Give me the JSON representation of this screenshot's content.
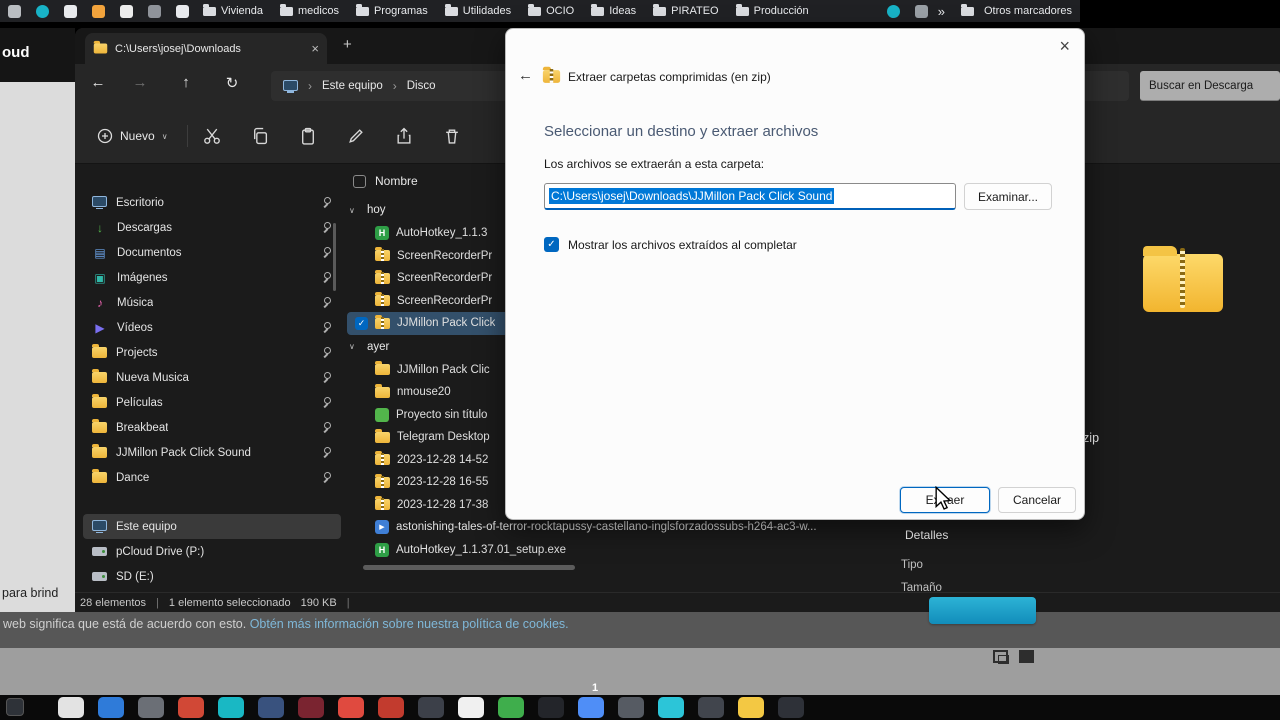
{
  "icon_glyphs": {
    "close": "×",
    "back": "←",
    "forward": "→",
    "up": "↑",
    "refresh": "↻",
    "crumb": "›",
    "plus": "+",
    "chevron": "∨",
    "check": "✓",
    "downloads": "↓",
    "documents": "▤",
    "pictures": "▣",
    "music": "♪",
    "videos": "▶"
  },
  "bookmarks": {
    "leading": [
      {
        "color": "#b9bdc1",
        "round": false
      },
      {
        "color": "#18b3c7",
        "round": true
      },
      {
        "color": "#e8eaed",
        "round": false
      },
      {
        "color": "#f2a33c",
        "round": false
      },
      {
        "color": "#ececec",
        "round": false
      },
      {
        "color": "#8f939a",
        "round": false
      },
      {
        "color": "#e8eaed",
        "round": false
      }
    ],
    "folders": [
      "Vivienda",
      "medicos",
      "Programas",
      "Utilidades",
      "OCIO",
      "Ideas",
      "PIRATEO",
      "Producción"
    ],
    "trailing": [
      {
        "color": "#18b3c7",
        "round": true
      },
      {
        "color": "#9aa0a6",
        "round": false
      }
    ],
    "overflow_chevron": "»",
    "other_bookmarks": "Otros marcadores"
  },
  "explorer": {
    "tab_title": "C:\\Users\\josej\\Downloads",
    "breadcrumb": {
      "item1": "Este equipo",
      "item2": "Disco"
    },
    "search_text": "Buscar en Descarga",
    "new_button": "Nuevo",
    "sidebar": {
      "pinned": [
        {
          "label": "Escritorio",
          "icon": "desktop"
        },
        {
          "label": "Descargas",
          "icon": "downloads"
        },
        {
          "label": "Documentos",
          "icon": "documents"
        },
        {
          "label": "Imágenes",
          "icon": "pictures"
        },
        {
          "label": "Música",
          "icon": "music"
        },
        {
          "label": "Vídeos",
          "icon": "videos"
        },
        {
          "label": "Projects",
          "icon": "folder"
        },
        {
          "label": "Nueva Musica",
          "icon": "folder"
        },
        {
          "label": "Películas",
          "icon": "folder"
        },
        {
          "label": "Breakbeat",
          "icon": "folder"
        },
        {
          "label": "JJMillon Pack Click Sound",
          "icon": "folder"
        },
        {
          "label": "Dance",
          "icon": "folder"
        }
      ],
      "devices": [
        {
          "label": "Este equipo",
          "icon": "computer",
          "selected": true
        },
        {
          "label": "pCloud Drive (P:)",
          "icon": "drive",
          "selected": false
        },
        {
          "label": "SD (E:)",
          "icon": "drive",
          "selected": false
        }
      ]
    },
    "files": {
      "column": "Nombre",
      "groups": [
        {
          "label": "hoy",
          "items": [
            {
              "name": "AutoHotkey_1.1.3",
              "icon": "exe",
              "selected": false
            },
            {
              "name": "ScreenRecorderPr",
              "icon": "zip",
              "selected": false
            },
            {
              "name": "ScreenRecorderPr",
              "icon": "zip",
              "selected": false
            },
            {
              "name": "ScreenRecorderPr",
              "icon": "zip",
              "selected": false
            },
            {
              "name": "JJMillon Pack Click",
              "icon": "zip",
              "selected": true
            }
          ]
        },
        {
          "label": "ayer",
          "items": [
            {
              "name": "JJMillon Pack Clic",
              "icon": "folder",
              "selected": false
            },
            {
              "name": "nmouse20",
              "icon": "folder",
              "selected": false
            },
            {
              "name": "Proyecto sin título",
              "icon": "project",
              "selected": false
            },
            {
              "name": "Telegram Desktop",
              "icon": "folder",
              "selected": false
            },
            {
              "name": "2023-12-28 14-52",
              "icon": "zip",
              "selected": false
            },
            {
              "name": "2023-12-28 16-55",
              "icon": "zip",
              "selected": false
            },
            {
              "name": "2023-12-28 17-38",
              "icon": "zip",
              "selected": false
            },
            {
              "name": "astonishing-tales-of-terror-rocktapussy-castellano-inglsforzadossubs-h264-ac3-w...",
              "icon": "video",
              "selected": false
            },
            {
              "name": "AutoHotkey_1.1.37.01_setup.exe",
              "icon": "exe",
              "selected": false
            }
          ]
        }
      ]
    },
    "status": {
      "count": "28 elementos",
      "sep": "|",
      "selected": "1 elemento seleccionado",
      "size": "190 KB"
    },
    "preview": {
      "filename": "JJMillon Pack Click Sound.zip",
      "details": "Detalles",
      "field_type": "Tipo",
      "field_size": "Tamaño"
    }
  },
  "dialog": {
    "title": "Extraer carpetas comprimidas (en zip)",
    "heading": "Seleccionar un destino y extraer archivos",
    "path_label": "Los archivos se extraerán a esta carpeta:",
    "path_value": "C:\\Users\\josej\\Downloads\\JJMillon Pack Click Sound",
    "browse": "Examinar...",
    "show_files": "Mostrar los archivos extraídos al completar",
    "extract": "Extraer",
    "cancel": "Cancelar",
    "close": "×"
  },
  "background": {
    "window_fragment": "oud",
    "cookie_left": "para brind",
    "cookie_sentence": "web significa que está de acuerdo con esto.",
    "cookie_link": "Obtén más información sobre nuestra política de cookies."
  },
  "taskbar": {
    "badge": "1",
    "apps": [
      {
        "color": "#e3e3e3"
      },
      {
        "color": "#2f7bd9"
      },
      {
        "color": "#6b6f76"
      },
      {
        "color": "#d14836"
      },
      {
        "color": "#19b8c4"
      },
      {
        "color": "#39527e"
      },
      {
        "color": "#7a2430"
      },
      {
        "color": "#e04a3f"
      },
      {
        "color": "#c23b2e"
      },
      {
        "color": "#3c4049"
      },
      {
        "color": "#f0f0f0"
      },
      {
        "color": "#3fae4c"
      },
      {
        "color": "#23252a"
      },
      {
        "color": "#4f8ef7"
      },
      {
        "color": "#565b63"
      },
      {
        "color": "#2cc5d8"
      },
      {
        "color": "#41454d"
      },
      {
        "color": "#f3c843"
      },
      {
        "color": "#2e3138"
      }
    ]
  }
}
